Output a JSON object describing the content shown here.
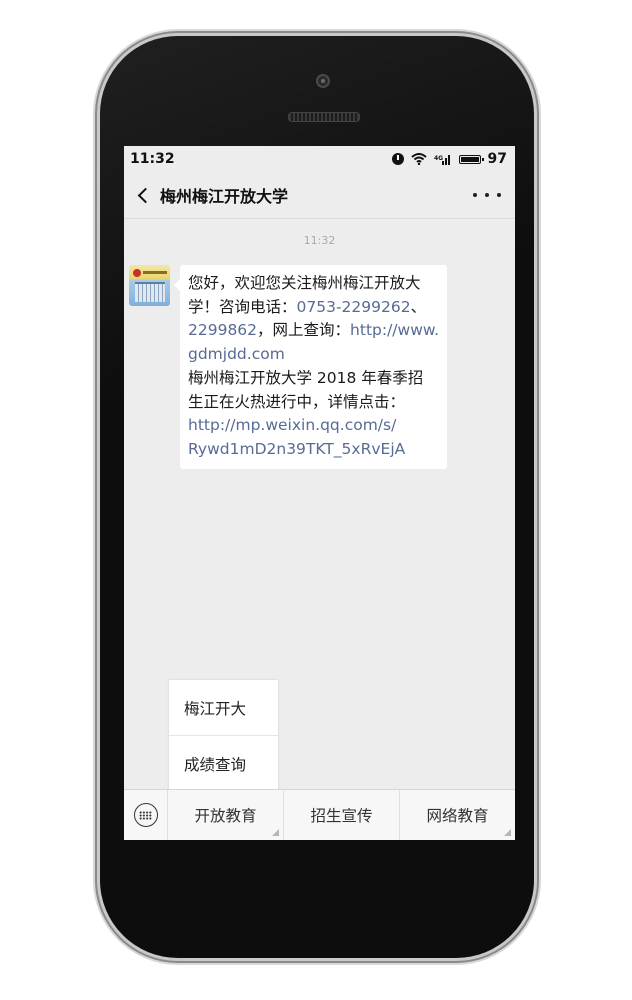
{
  "status_bar": {
    "time": "11:32",
    "battery": "97",
    "icons": [
      "alarm-icon",
      "wifi-icon",
      "signal-icon",
      "battery-icon"
    ]
  },
  "header": {
    "title": "梅州梅江开放大学",
    "back_icon": "chevron-left-icon",
    "more_icon": "ellipsis-icon"
  },
  "chat": {
    "timestamp": "11:32",
    "message": {
      "sender_avatar": "avatar-image",
      "lines": [
        {
          "parts": [
            {
              "text": "您好，欢迎您关注梅州梅江开放大",
              "link": false
            }
          ]
        },
        {
          "parts": [
            {
              "text": "学！咨询电话：",
              "link": false
            },
            {
              "text": "0753-2299262",
              "link": true
            },
            {
              "text": "、",
              "link": false
            }
          ]
        },
        {
          "parts": [
            {
              "text": "2299862",
              "link": true
            },
            {
              "text": "，网上查询：",
              "link": false
            },
            {
              "text": "http://www.",
              "link": true
            }
          ]
        },
        {
          "parts": [
            {
              "text": "gdmjdd.com",
              "link": true
            }
          ]
        },
        {
          "parts": [
            {
              "text": "梅州梅江开放大学 2018 年春季招",
              "link": false
            }
          ]
        },
        {
          "parts": [
            {
              "text": "生正在火热进行中，详情点击：",
              "link": false
            }
          ]
        },
        {
          "parts": [
            {
              "text": "http://mp.weixin.qq.com/s/",
              "link": true
            }
          ]
        },
        {
          "parts": [
            {
              "text": "Rywd1mD2n39TKT_5xRvEjA",
              "link": true
            }
          ]
        }
      ]
    }
  },
  "submenu": {
    "items": [
      "梅江开大",
      "成绩查询"
    ]
  },
  "bottom_menu": {
    "keyboard_icon": "keyboard-icon",
    "items": [
      "开放教育",
      "招生宣传",
      "网络教育"
    ]
  },
  "colors": {
    "link": "#576b95",
    "chat_background": "#ededed",
    "bubble": "#ffffff"
  }
}
